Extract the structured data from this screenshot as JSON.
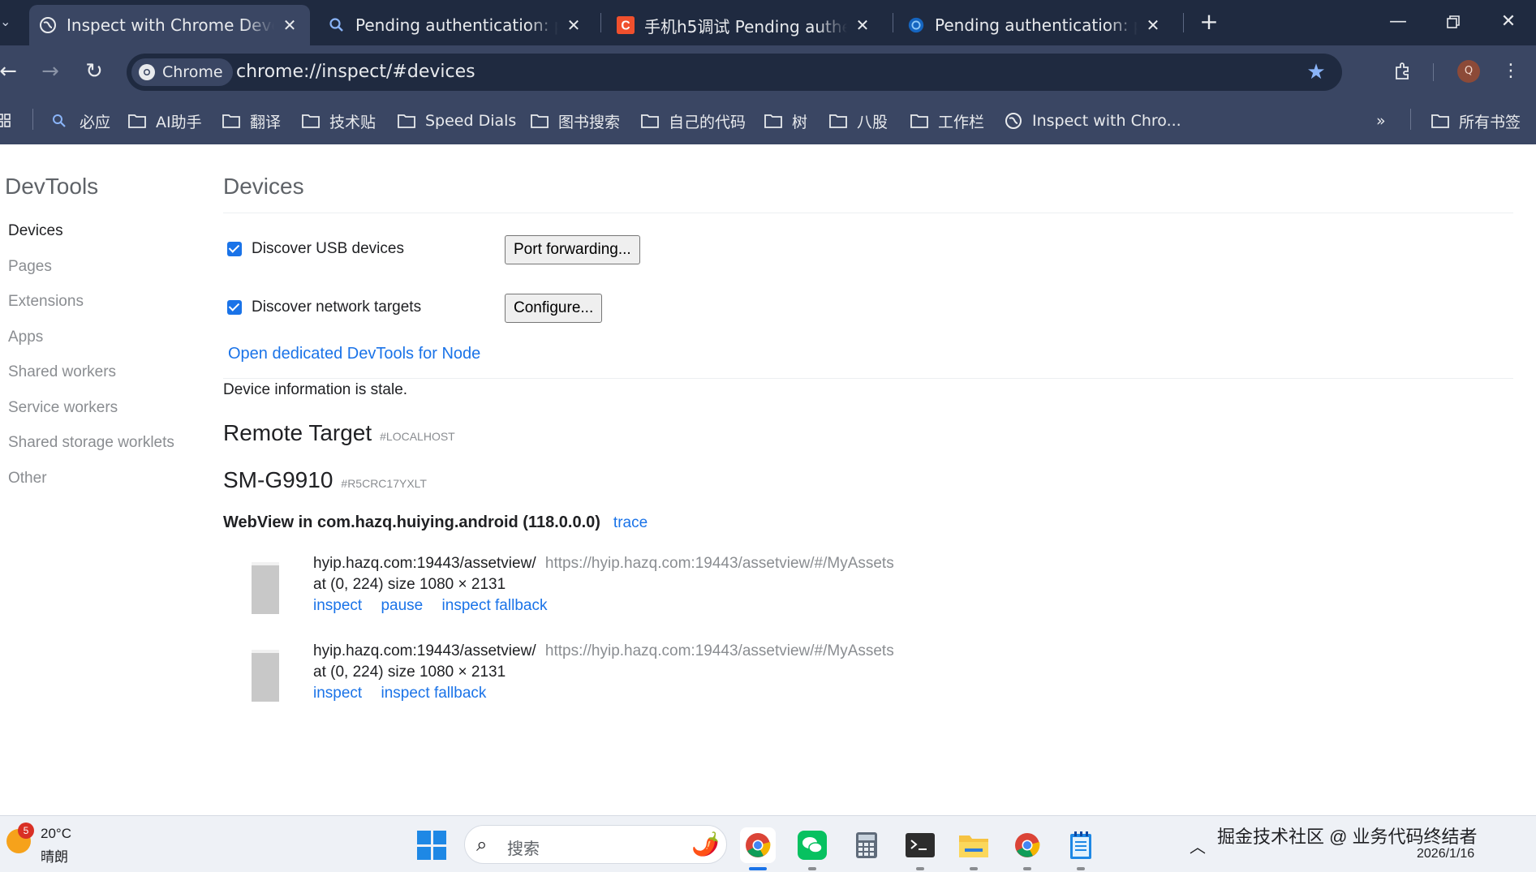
{
  "tabs": [
    {
      "title": "Inspect with Chrome Developer Tools",
      "active": true,
      "favicon": "globe-icon"
    },
    {
      "title": "Pending authentication: please",
      "active": false,
      "favicon": "search-icon"
    },
    {
      "title": "手机h5调试 Pending authentication",
      "active": false,
      "favicon": "csdn-icon"
    },
    {
      "title": "Pending authentication: please",
      "active": false,
      "favicon": "edge-icon"
    }
  ],
  "toolbar": {
    "chip_label": "Chrome",
    "url": "chrome://inspect/#devices"
  },
  "bookmarks": [
    {
      "label": "必应",
      "icon": "search-icon"
    },
    {
      "label": "AI助手",
      "icon": "folder-icon"
    },
    {
      "label": "翻译",
      "icon": "folder-icon"
    },
    {
      "label": "技术贴",
      "icon": "folder-icon"
    },
    {
      "label": "Speed Dials",
      "icon": "folder-icon"
    },
    {
      "label": "图书搜索",
      "icon": "folder-icon"
    },
    {
      "label": "自己的代码",
      "icon": "folder-icon"
    },
    {
      "label": "树",
      "icon": "folder-icon"
    },
    {
      "label": "八股",
      "icon": "folder-icon"
    },
    {
      "label": "工作栏",
      "icon": "folder-icon"
    },
    {
      "label": "Inspect with Chro...",
      "icon": "globe-icon"
    }
  ],
  "bookmarks_overflow": "»",
  "all_bookmarks": "所有书签",
  "sidebar": {
    "title": "DevTools",
    "items": [
      {
        "label": "Devices",
        "selected": true
      },
      {
        "label": "Pages"
      },
      {
        "label": "Extensions"
      },
      {
        "label": "Apps"
      },
      {
        "label": "Shared workers"
      },
      {
        "label": "Service workers"
      },
      {
        "label": "Shared storage worklets"
      },
      {
        "label": "Other"
      }
    ]
  },
  "main": {
    "title": "Devices",
    "discover_usb": "Discover USB devices",
    "port_forwarding": "Port forwarding...",
    "discover_network": "Discover network targets",
    "configure": "Configure...",
    "node_link": "Open dedicated DevTools for Node",
    "stale": "Device information is stale.",
    "remote_title": "Remote Target",
    "remote_sub": "#LOCALHOST",
    "device_name": "SM-G9910",
    "device_serial": "#R5CRC17YXLT",
    "webview_title": "WebView in com.hazq.huiying.android (118.0.0.0)",
    "trace": "trace",
    "targets": [
      {
        "name": "hyip.hazq.com:19443/assetview/",
        "url": "https://hyip.hazq.com:19443/assetview/#/MyAssets",
        "info": "at (0, 224)  size 1080 × 2131",
        "actions": [
          "inspect",
          "pause",
          "inspect fallback"
        ]
      },
      {
        "name": "hyip.hazq.com:19443/assetview/",
        "url": "https://hyip.hazq.com:19443/assetview/#/MyAssets",
        "info": "at (0, 224)  size 1080 × 2131",
        "actions": [
          "inspect",
          "inspect fallback"
        ]
      }
    ]
  },
  "taskbar": {
    "weather_badge": "5",
    "weather_temp": "20°C",
    "weather_cond": "晴朗",
    "search_placeholder": "搜索",
    "clock_text": "掘金技术社区 @ 业务代码终结者",
    "date": "2026/1/16"
  },
  "colors": {
    "titlebar": "#1f2a40",
    "toolbar": "#3a4663",
    "link": "#1a73e8",
    "checkbox": "#1a73e8"
  }
}
